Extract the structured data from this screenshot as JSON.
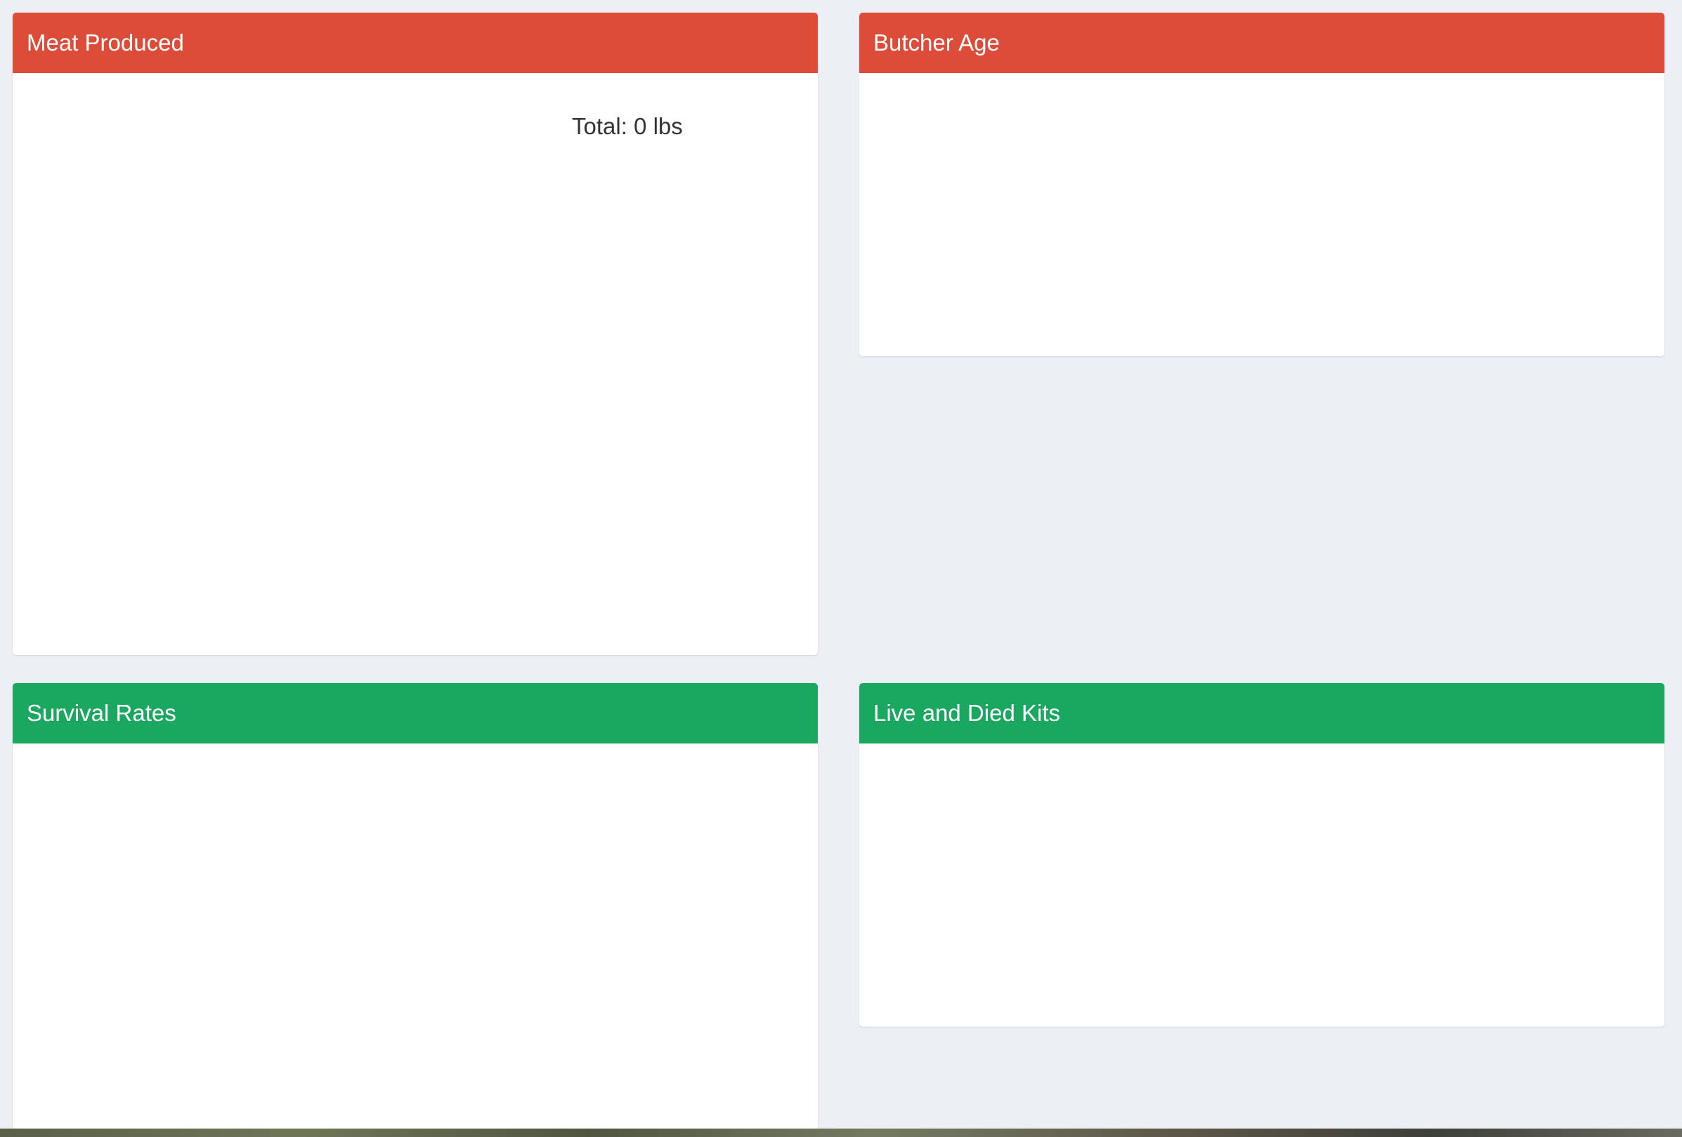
{
  "panels": {
    "meat_produced": {
      "title": "Meat Produced",
      "total_label": "Total: 0 lbs",
      "header_color": "#dd4b39"
    },
    "butcher_age": {
      "title": "Butcher Age",
      "header_color": "#dd4b39"
    },
    "survival_rates": {
      "title": "Survival Rates",
      "header_color": "#1aa75f"
    },
    "live_and_died_kits": {
      "title": "Live and Died Kits",
      "header_color": "#1aa75f"
    }
  },
  "background_color": "#ecf0f5"
}
